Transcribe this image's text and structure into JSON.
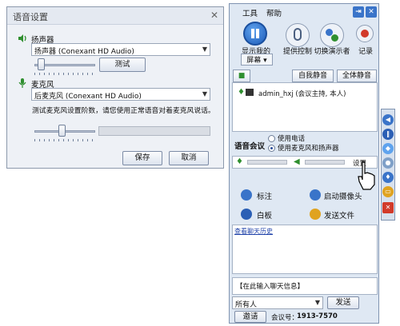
{
  "dialog": {
    "title": "语音设置",
    "speaker_label": "扬声器",
    "speaker_device": "扬声器 (Conexant HD Audio)",
    "test_button": "测试",
    "mic_label": "麦克风",
    "mic_device": "后麦克风 (Conexant HD Audio)",
    "mic_hint": "测试麦克风设置阶数，请您使用正常语音对着麦克风说话。",
    "save_button": "保存",
    "cancel_button": "取消"
  },
  "panel": {
    "menu": [
      "工具",
      "帮助"
    ],
    "toolbar": [
      {
        "label": "显示我的",
        "icon": "pause-icon"
      },
      {
        "label": "提供控制",
        "icon": "mouse-icon"
      },
      {
        "label": "切换演示者",
        "icon": "switch-presenter-icon"
      },
      {
        "label": "记录",
        "icon": "record-icon"
      }
    ],
    "screen_dropdown": "屏幕",
    "mute_self": "自我静音",
    "mute_all": "全体静音",
    "participant": "admin_hxj (会议主持, 本人)",
    "voice_label": "语音会议",
    "voice_options": [
      "使用电话",
      "使用麦克风和扬声器"
    ],
    "voice_selected": 1,
    "settings_link": "设置",
    "actions": [
      {
        "label": "标注",
        "icon": "annotate-icon"
      },
      {
        "label": "启动摄像头",
        "icon": "camera-icon"
      },
      {
        "label": "白板",
        "icon": "whiteboard-icon"
      },
      {
        "label": "发送文件",
        "icon": "send-file-icon"
      }
    ],
    "chat_history_link": "查看聊天历史",
    "chat_placeholder": "【在此输入聊天信息】",
    "recipient": "所有人",
    "send_button": "发送",
    "invite_button": "邀请",
    "meeting_id_label": "会议号：",
    "meeting_id": "1913-7570"
  },
  "sidebar_icons": [
    "arrow-left-icon",
    "pause-icon",
    "share-icon",
    "mouse-icon",
    "mic-icon",
    "chat-icon",
    "close-icon"
  ]
}
